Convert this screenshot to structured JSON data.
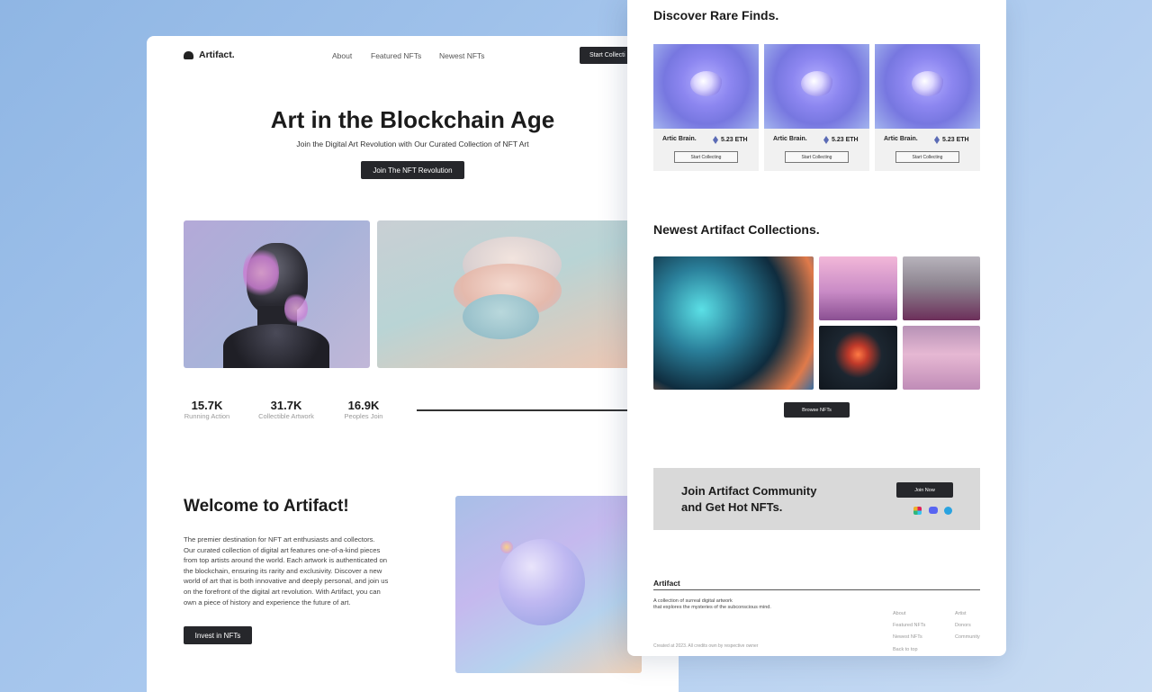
{
  "brand": "Artifact.",
  "nav": {
    "about": "About",
    "featured": "Featured NFTs",
    "newest": "Newest NFTs",
    "cta": "Start Collecti"
  },
  "hero": {
    "title": "Art in the Blockchain Age",
    "subtitle": "Join the Digital Art Revolution with Our Curated Collection of NFT Art",
    "cta": "Join The NFT Revolution"
  },
  "stats": [
    {
      "value": "15.7K",
      "label": "Running Action"
    },
    {
      "value": "31.7K",
      "label": "Collectible Artwork"
    },
    {
      "value": "16.9K",
      "label": "Peoples Join"
    }
  ],
  "welcome": {
    "title": "Welcome to Artifact!",
    "lines": [
      "The premier destination for NFT art enthusiasts and collectors.",
      "Our curated collection of digital art features one-of-a-kind pieces",
      "from top artists around the world. Each artwork is authenticated on",
      "the blockchain, ensuring its rarity and exclusivity. Discover a new",
      "world of art that is both innovative and deeply personal, and join us",
      "on the forefront of the digital art revolution. With Artifact, you can",
      "own a piece of history and experience the future of art."
    ],
    "cta": "Invest in NFTs"
  },
  "rare": {
    "title": "Discover Rare Finds.",
    "items": [
      {
        "name": "Artic Brain.",
        "price": "5.23 ETH",
        "cta": "Start Collecting"
      },
      {
        "name": "Artic Brain.",
        "price": "5.23 ETH",
        "cta": "Start Collecting"
      },
      {
        "name": "Artic Brain.",
        "price": "5.23 ETH",
        "cta": "Start Collecting"
      }
    ]
  },
  "collections": {
    "title": "Newest Artifact Collections.",
    "cta": "Browse NFTs"
  },
  "community": {
    "line1": "Join Artifact Community",
    "line2": "and Get Hot NFTs.",
    "cta": "Join Now",
    "icons": [
      "slack-icon",
      "discord-icon",
      "telegram-icon"
    ]
  },
  "footer": {
    "brand": "Artifact",
    "tagline1": "A collection of surreal digital artwork",
    "tagline2": "that explores the mysteries of the subconscious mind.",
    "col1": [
      "About",
      "Featured NFTs",
      "Newest NFTs",
      "Back to top"
    ],
    "col2": [
      "Artist",
      "Donors",
      "Community"
    ],
    "credit": "Created at 2023. All credits own by respective owner"
  }
}
